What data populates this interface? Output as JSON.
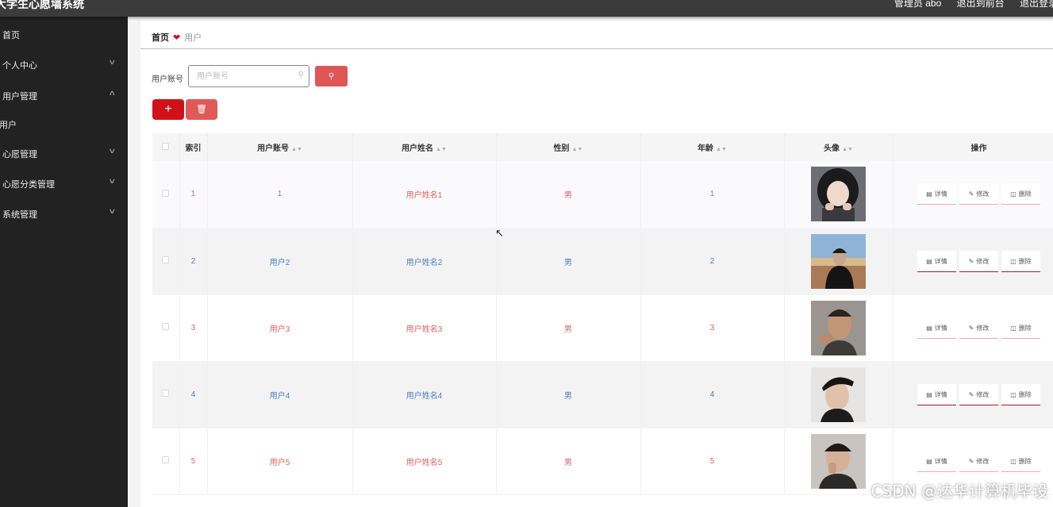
{
  "app": {
    "title": "大学生心愿墙系统",
    "header_links": [
      "管理员 abo",
      "退出到前台",
      "退出登录"
    ]
  },
  "sidebar": {
    "items": [
      {
        "label": "首页",
        "chevron": false
      },
      {
        "label": "个人中心",
        "chevron": true
      },
      {
        "label": "用户管理",
        "chevron": true
      },
      {
        "label": "用户",
        "chevron": false,
        "sub": true
      },
      {
        "label": "心愿管理",
        "chevron": true
      },
      {
        "label": "心愿分类管理",
        "chevron": true
      },
      {
        "label": "系统管理",
        "chevron": true
      }
    ]
  },
  "breadcrumb": {
    "home": "首页",
    "current": "用户"
  },
  "search": {
    "label": "用户账号",
    "placeholder": "用户账号",
    "value": ""
  },
  "icons": {
    "add": "plus-icon",
    "delete": "trash-icon",
    "search": "search-icon",
    "detail": "document-icon",
    "edit": "pencil-icon",
    "sort": "sort-caret-icon"
  },
  "table": {
    "columns": [
      "索引",
      "用户账号",
      "用户姓名",
      "性别",
      "年龄",
      "头像",
      "操作"
    ],
    "rows": [
      {
        "index": "1",
        "account": "1",
        "name": "用户姓名1",
        "gender": "男",
        "age": "1"
      },
      {
        "index": "2",
        "account": "用户2",
        "name": "用户姓名2",
        "gender": "男",
        "age": "2"
      },
      {
        "index": "3",
        "account": "用户3",
        "name": "用户姓名3",
        "gender": "男",
        "age": "3"
      },
      {
        "index": "4",
        "account": "用户4",
        "name": "用户姓名4",
        "gender": "男",
        "age": "4"
      },
      {
        "index": "5",
        "account": "用户5",
        "name": "用户姓名5",
        "gender": "男",
        "age": "5"
      }
    ],
    "actions": [
      "详情",
      "修改",
      "删除"
    ]
  },
  "colors": {
    "primary": "#d01218",
    "accent_red": "#e06060",
    "accent_blue": "#4a7fbe",
    "sidebar": "#222222",
    "topbar": "#3b3b3b"
  },
  "watermark": "CSDN @达华计算机毕设"
}
